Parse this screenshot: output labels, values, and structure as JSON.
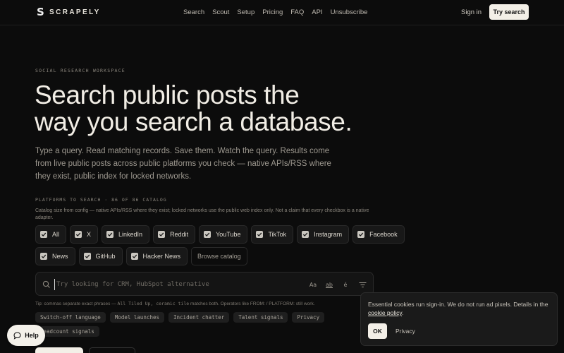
{
  "header": {
    "logo_mark": "S",
    "logo_text": "SCRAPELY",
    "nav": [
      "Search",
      "Scout",
      "Setup",
      "Pricing",
      "FAQ",
      "API",
      "Unsubscribe"
    ],
    "signin_label": "Sign in",
    "try_label": "Try search"
  },
  "hero": {
    "eyebrow": "SOCIAL RESEARCH WORKSPACE",
    "title_line1": "Search public posts the",
    "title_line2": "way you search a database.",
    "subtitle": "Type a query. Read matching records. Save them. Watch the query. Results come from live public posts across public platforms you check — native APIs/RSS where they exist, public index for locked networks."
  },
  "platforms": {
    "label": "PLATFORMS TO SEARCH · 86 OF 86 CATALOG",
    "note": "Catalog size from config — native APIs/RSS where they exist; locked networks use the public web index only. Not a claim that every checkbox is a native adapter.",
    "row1": [
      "All",
      "X",
      "LinkedIn",
      "Reddit",
      "YouTube",
      "TikTok",
      "Instagram",
      "Facebook"
    ],
    "row2": [
      "News",
      "GitHub",
      "Hacker News"
    ],
    "browse_label": "Browse catalog"
  },
  "search": {
    "placeholder": "Try looking for CRM, HubSpot alternative",
    "value": "",
    "tool_icons": [
      "case-sensitive-icon",
      "whole-word-icon",
      "accent-icon",
      "filter-icon"
    ],
    "tool_glyphs": [
      "Aa",
      "ab",
      "é"
    ]
  },
  "tip": {
    "prefix": "Tip: commas separate exact phrases — ",
    "example": "All Tiled Up, ceramic tile",
    "suffix": " matches both. Operators like FROM: / PLATFORM: still work."
  },
  "tags": {
    "row1": [
      "Switch-off language",
      "Model launches",
      "Incident chatter",
      "Talent signals",
      "Privacy"
    ],
    "row2": [
      "Headcount signals"
    ]
  },
  "help": {
    "label": "Help"
  },
  "cookie": {
    "text": "Essential cookies run sign-in. We do not run ad pixels. Details in the ",
    "link": "cookie policy",
    "text_end": ".",
    "ok_label": "OK",
    "privacy_label": "Privacy"
  }
}
